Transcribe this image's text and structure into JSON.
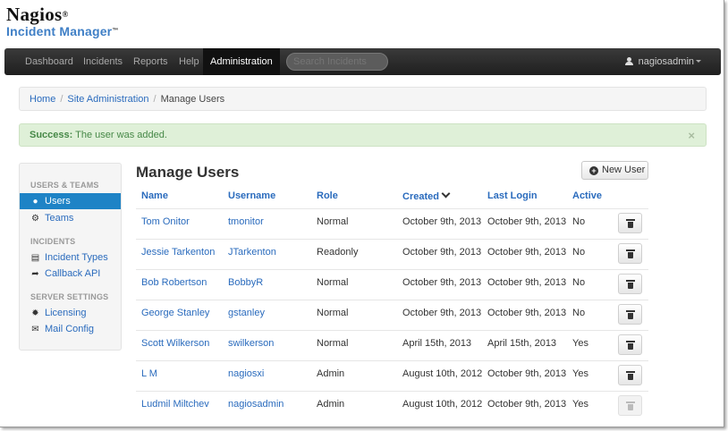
{
  "brand": {
    "line1": "Nagios",
    "line2": "Incident Manager",
    "mark1": "®",
    "mark2": "™"
  },
  "nav": {
    "items": [
      "Dashboard",
      "Incidents",
      "Reports",
      "Help",
      "Administration"
    ],
    "active": "Administration",
    "search_placeholder": "Search Incidents",
    "user": "nagiosadmin"
  },
  "breadcrumb": {
    "items": [
      "Home",
      "Site Administration"
    ],
    "current": "Manage Users",
    "separator": "/"
  },
  "alert": {
    "strong": "Success:",
    "message": "The user was added.",
    "close": "×"
  },
  "sidebar": {
    "sections": [
      {
        "header": "USERS & TEAMS",
        "items": [
          {
            "label": "Users",
            "icon": "user-icon",
            "active": true
          },
          {
            "label": "Teams",
            "icon": "gear-icon",
            "active": false
          }
        ]
      },
      {
        "header": "INCIDENTS",
        "items": [
          {
            "label": "Incident Types",
            "icon": "list-icon",
            "active": false
          },
          {
            "label": "Callback API",
            "icon": "share-arrow-icon",
            "active": false
          }
        ]
      },
      {
        "header": "SERVER SETTINGS",
        "items": [
          {
            "label": "Licensing",
            "icon": "certificate-icon",
            "active": false
          },
          {
            "label": "Mail Config",
            "icon": "envelope-icon",
            "active": false
          }
        ]
      }
    ]
  },
  "main": {
    "title": "Manage Users",
    "new_button": "New User",
    "columns": [
      "Name",
      "Username",
      "Role",
      "Created",
      "Last Login",
      "Active"
    ],
    "sorted_column": "Created",
    "rows": [
      {
        "name": "Tom Onitor",
        "username": "tmonitor",
        "role": "Normal",
        "created": "October 9th, 2013",
        "last_login": "October 9th, 2013",
        "active": "No",
        "delete_enabled": true
      },
      {
        "name": "Jessie Tarkenton",
        "username": "JTarkenton",
        "role": "Readonly",
        "created": "October 9th, 2013",
        "last_login": "October 9th, 2013",
        "active": "No",
        "delete_enabled": true
      },
      {
        "name": "Bob Robertson",
        "username": "BobbyR",
        "role": "Normal",
        "created": "October 9th, 2013",
        "last_login": "October 9th, 2013",
        "active": "No",
        "delete_enabled": true
      },
      {
        "name": "George Stanley",
        "username": "gstanley",
        "role": "Normal",
        "created": "October 9th, 2013",
        "last_login": "October 9th, 2013",
        "active": "No",
        "delete_enabled": true
      },
      {
        "name": "Scott Wilkerson",
        "username": "swilkerson",
        "role": "Normal",
        "created": "April 15th, 2013",
        "last_login": "April 15th, 2013",
        "active": "Yes",
        "delete_enabled": true
      },
      {
        "name": "L M",
        "username": "nagiosxi",
        "role": "Admin",
        "created": "August 10th, 2012",
        "last_login": "October 9th, 2013",
        "active": "Yes",
        "delete_enabled": true
      },
      {
        "name": "Ludmil Miltchev",
        "username": "nagiosadmin",
        "role": "Admin",
        "created": "August 10th, 2012",
        "last_login": "October 9th, 2013",
        "active": "Yes",
        "delete_enabled": false
      }
    ]
  },
  "colors": {
    "link": "#2a6bbd",
    "brand_blue": "#3f7fc6",
    "active_blue": "#1e83c6",
    "success_bg": "#dff0d8",
    "success_text": "#468847",
    "navbar": "#222222"
  }
}
